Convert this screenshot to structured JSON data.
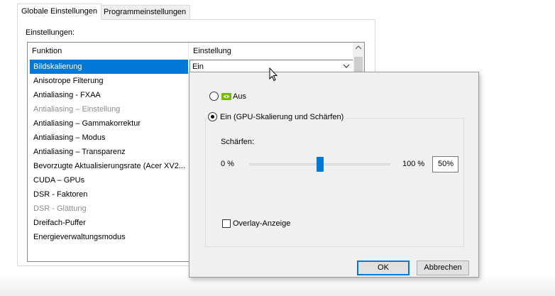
{
  "tabs": [
    {
      "label": "Globale Einstellungen",
      "active": true
    },
    {
      "label": "Programmeinstellungen",
      "active": false
    }
  ],
  "settings_label": "Einstellungen:",
  "table": {
    "headers": [
      "Funktion",
      "Einstellung"
    ],
    "rows": [
      {
        "label": "Bildskalierung",
        "state": "selected"
      },
      {
        "label": "Anisotrope Filterung",
        "state": "normal"
      },
      {
        "label": "Antialiasing - FXAA",
        "state": "normal"
      },
      {
        "label": "Antialiasing – Einstellung",
        "state": "disabled"
      },
      {
        "label": "Antialiasing – Gammakorrektur",
        "state": "normal"
      },
      {
        "label": "Antialiasing – Modus",
        "state": "normal"
      },
      {
        "label": "Antialiasing – Transparenz",
        "state": "normal"
      },
      {
        "label": "Bevorzugte Aktualisierungsrate (Acer XV2...",
        "state": "normal"
      },
      {
        "label": "CUDA – GPUs",
        "state": "normal"
      },
      {
        "label": "DSR - Faktoren",
        "state": "normal"
      },
      {
        "label": "DSR - Glättung",
        "state": "disabled"
      },
      {
        "label": "Dreifach-Puffer",
        "state": "normal"
      },
      {
        "label": "Energieverwaltungsmodus",
        "state": "normal"
      }
    ],
    "selected_value": "Ein"
  },
  "popup": {
    "option_off": "Aus",
    "option_on": "Ein (GPU-Skalierung und Schärfen)",
    "sharpen_label": "Schärfen:",
    "slider_min": "0 %",
    "slider_max": "100 %",
    "slider_value_text": "50%",
    "slider_value": 0.5,
    "overlay_label": "Overlay-Anzeige",
    "overlay_checked": false,
    "ok_label": "OK",
    "cancel_label": "Abbrechen"
  },
  "icons": {
    "nvidia": "nvidia-logo-icon",
    "chevron": "chevron-down-icon",
    "cursor": "mouse-cursor-icon"
  },
  "colors": {
    "selection": "#0078d7",
    "nvidia_green": "#76b900"
  }
}
